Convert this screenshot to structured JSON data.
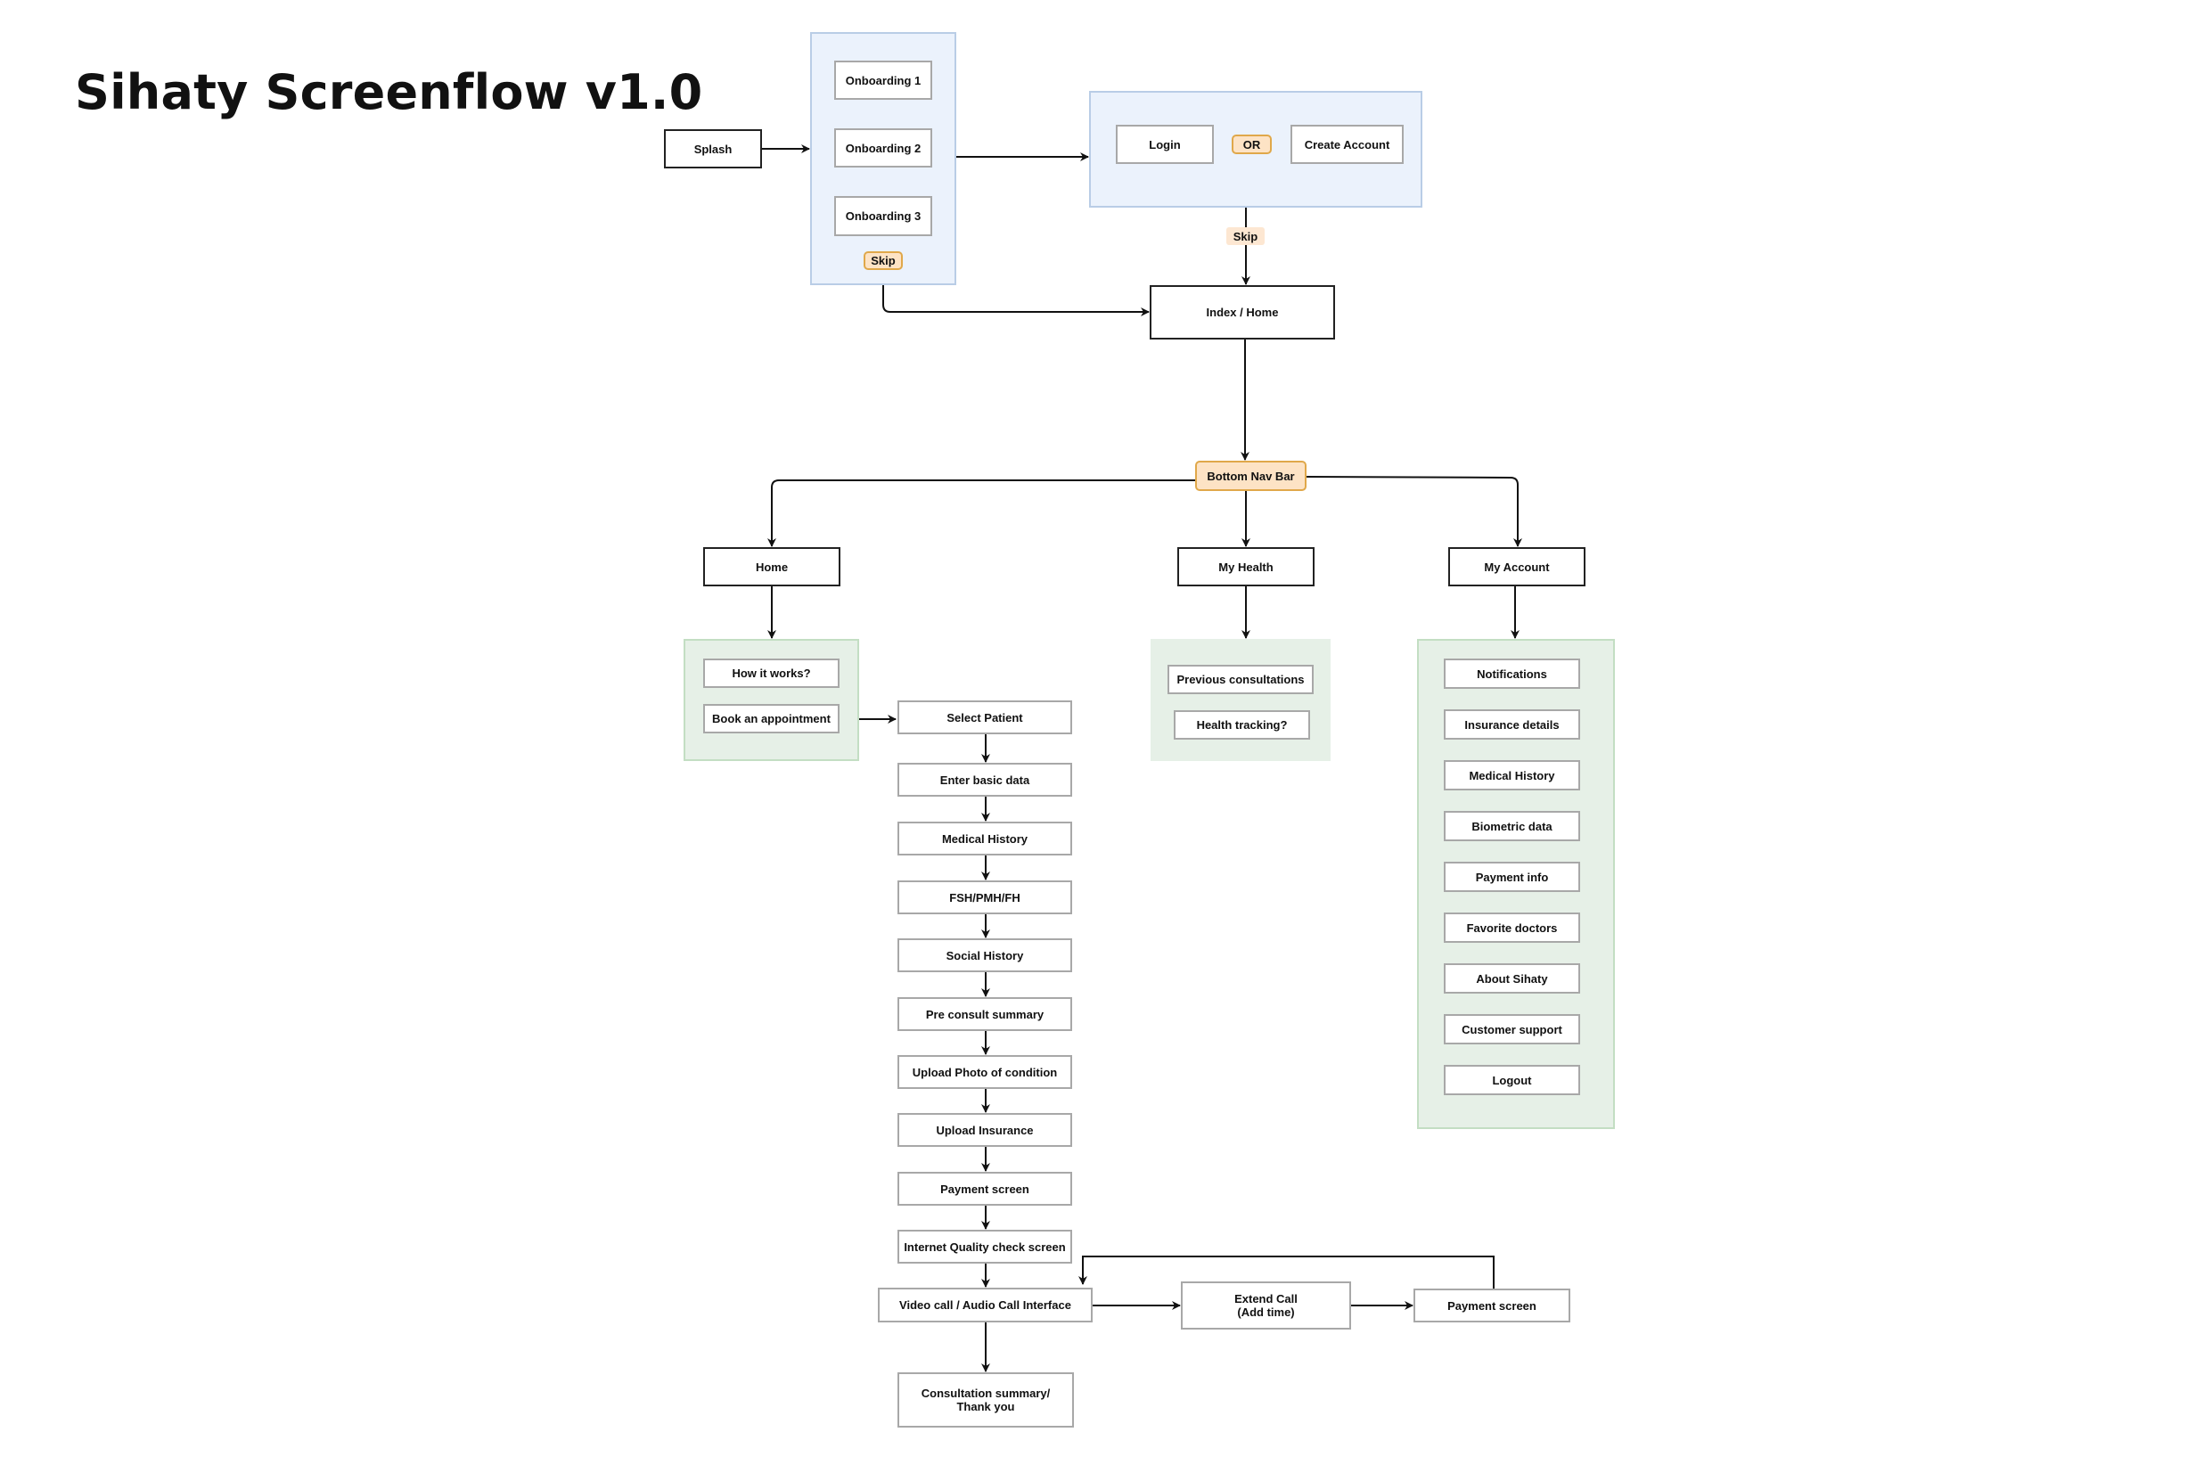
{
  "title": "Sihaty Screenflow v1.0",
  "colors": {
    "container_blue": "#ebf2fc",
    "container_green": "#e6f0e7",
    "tag_fill": "#fde3c5",
    "tag_border": "#e0a84a"
  },
  "nodes": {
    "splash": "Splash",
    "onboarding": [
      "Onboarding 1",
      "Onboarding 2",
      "Onboarding 3"
    ],
    "onboarding_skip": "Skip",
    "login": "Login",
    "or": "OR",
    "create_account": "Create Account",
    "auth_skip": "Skip",
    "index_home": "Index / Home",
    "bottom_nav": "Bottom Nav Bar",
    "tabs": [
      "Home",
      "My Health",
      "My Account"
    ],
    "home_items": [
      "How it works?",
      "Book an appointment"
    ],
    "booking_flow": [
      "Select Patient",
      "Enter basic data",
      "Medical History",
      "FSH/PMH/FH",
      "Social History",
      "Pre consult summary",
      "Upload Photo of condition",
      "Upload Insurance",
      "Payment screen",
      "Internet Quality check screen"
    ],
    "video_call": "Video call / Audio Call Interface",
    "extend_call": [
      "Extend Call",
      "(Add time)"
    ],
    "extend_payment": "Payment screen",
    "consultation_summary": [
      "Consultation summary/",
      "Thank you"
    ],
    "my_health_items": [
      "Previous consultations",
      "Health tracking?"
    ],
    "my_account_items": [
      "Notifications",
      "Insurance details",
      "Medical History",
      "Biometric data",
      "Payment info",
      "Favorite doctors",
      "About Sihaty",
      "Customer support",
      "Logout"
    ]
  }
}
